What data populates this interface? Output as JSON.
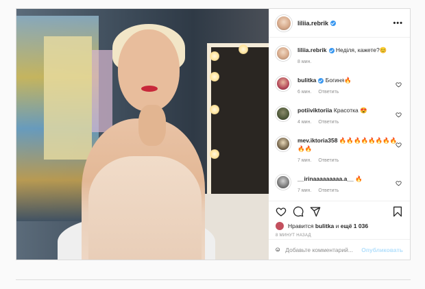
{
  "post": {
    "author": "liliia.rebrik",
    "caption": "Неділя, кажете?😊",
    "caption_time": "8 мин."
  },
  "comments": [
    {
      "user": "bulitka",
      "verified": true,
      "text": "Богиня🔥",
      "time": "6 мин.",
      "reply": "Ответить"
    },
    {
      "user": "potiiviktoriia",
      "verified": false,
      "text": "Красотка 😍",
      "time": "4 мин.",
      "reply": "Ответить"
    },
    {
      "user": "mev.iktoria358",
      "verified": false,
      "text": "🔥🔥🔥🔥🔥🔥🔥🔥🔥🔥",
      "time": "7 мин.",
      "reply": "Ответить"
    },
    {
      "user": "__irinaaaaaaaaa.a__",
      "verified": false,
      "text": "🔥",
      "time": "7 мин.",
      "reply": "Ответить"
    }
  ],
  "likes": {
    "prefix": "Нравится",
    "first_user": "bulitka",
    "middle": "и",
    "others": "ещё 1 036"
  },
  "time_ago": "8 МИНУТ НАЗАД",
  "add_comment": {
    "placeholder": "Добавьте комментарий...",
    "publish_label": "Опубликовать"
  },
  "icons": {
    "more": "more-options-icon",
    "heart": "heart-icon",
    "comment": "comment-icon",
    "share": "share-icon",
    "bookmark": "bookmark-icon",
    "emoji": "emoji-icon"
  },
  "colors": {
    "verified": "#3897f0",
    "publish": "#b2dffc",
    "meta": "#8e8e8e"
  }
}
